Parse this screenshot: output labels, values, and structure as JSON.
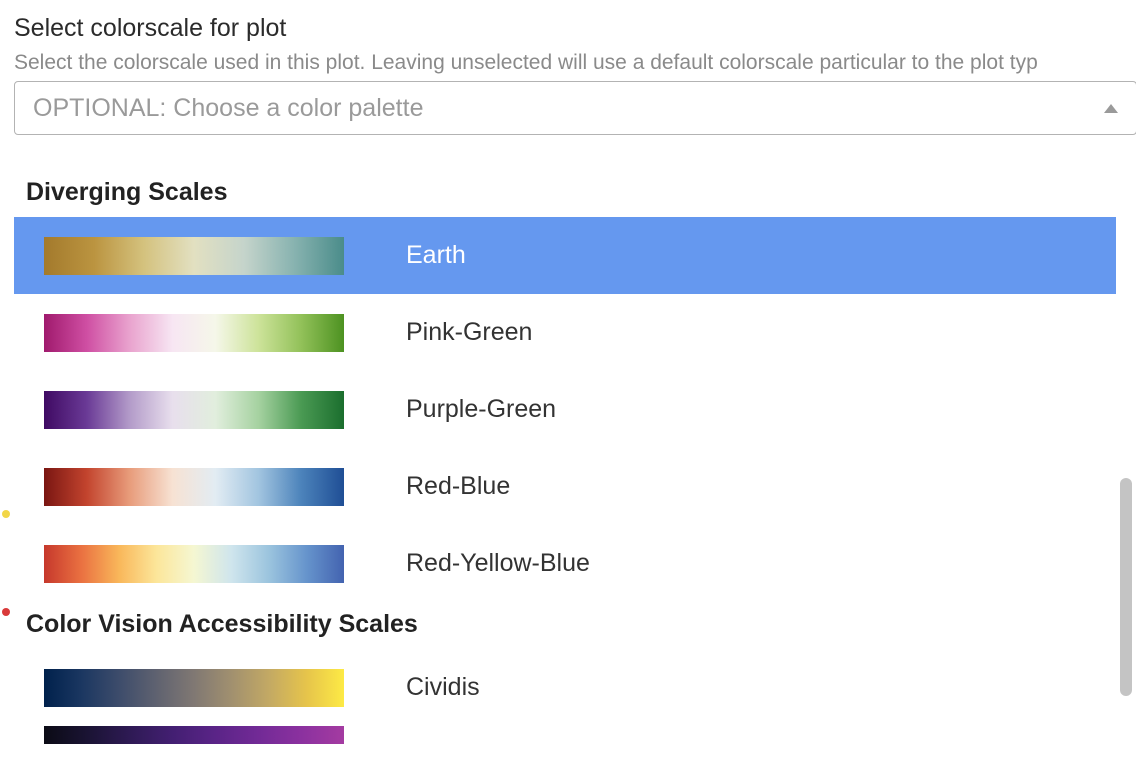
{
  "field": {
    "title": "Select colorscale for plot",
    "description": "Select the colorscale used in this plot. Leaving unselected will use a default colorscale particular to the plot typ",
    "placeholder": "OPTIONAL: Choose a color palette"
  },
  "groups": [
    {
      "key": "diverging",
      "label": "Diverging Scales",
      "options": [
        {
          "key": "earth",
          "label": "Earth",
          "gradient_class": "grad-earth",
          "selected": true
        },
        {
          "key": "pink-green",
          "label": "Pink-Green",
          "gradient_class": "grad-pink-green",
          "selected": false
        },
        {
          "key": "purple-green",
          "label": "Purple-Green",
          "gradient_class": "grad-purple-green",
          "selected": false
        },
        {
          "key": "red-blue",
          "label": "Red-Blue",
          "gradient_class": "grad-red-blue",
          "selected": false
        },
        {
          "key": "red-yellow-blue",
          "label": "Red-Yellow-Blue",
          "gradient_class": "grad-red-yellow-blue",
          "selected": false
        }
      ]
    },
    {
      "key": "cva",
      "label": "Color Vision Accessibility Scales",
      "options": [
        {
          "key": "cividis",
          "label": "Cividis",
          "gradient_class": "grad-cividis",
          "selected": false
        }
      ]
    }
  ]
}
